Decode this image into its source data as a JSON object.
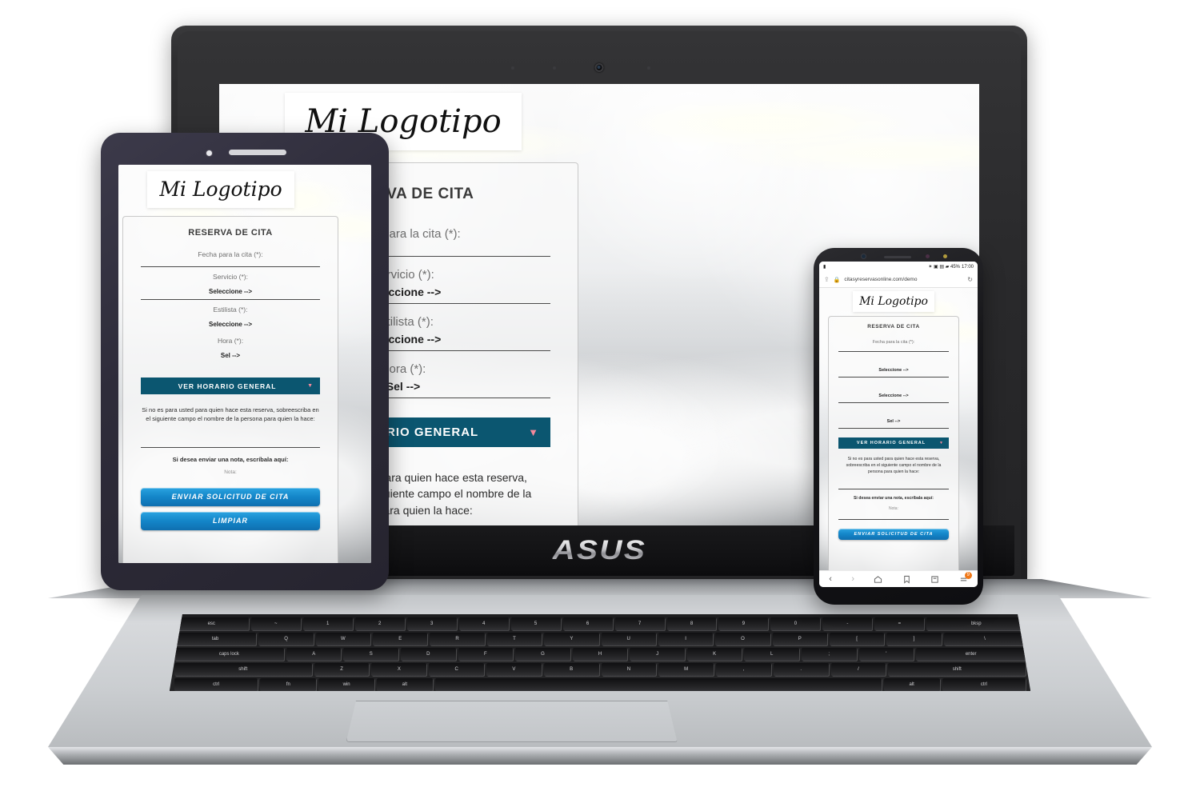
{
  "site": {
    "logo_text": "Mi Logotipo",
    "card_title": "RESERVA DE CITA",
    "fields": [
      {
        "label": "Fecha para la cita (*):",
        "value": ""
      },
      {
        "label": "Servicio (*):",
        "value": "Seleccione -->"
      },
      {
        "label": "Estilista (*):",
        "value": "Seleccione -->"
      },
      {
        "label": "Hora (*):",
        "value": "Sel -->"
      }
    ],
    "schedule_button": {
      "label": "VER HORARIO GENERAL",
      "arrow": "▼"
    },
    "note_paragraph": "Si no es para usted para quien hace esta reserva, sobreescriba en el siguiente campo el nombre de la persona para quien la hace:",
    "note_prompt": "Si desea enviar una nota, escríbala aquí:",
    "note_placeholder": "Nota:",
    "submit_button": "ENVIAR SOLICITUD DE CITA",
    "clear_button": "LIMPIAR",
    "colors": {
      "teal": "#0b5670",
      "arrow_pink": "#f4899b",
      "blue_button": "#1486c9"
    }
  },
  "laptop": {
    "brand": "ASUS",
    "keyboard": {
      "row1": [
        "esc",
        "~",
        "1",
        "2",
        "3",
        "4",
        "5",
        "6",
        "7",
        "8",
        "9",
        "0",
        "-",
        "=",
        "bksp"
      ],
      "row2": [
        "tab",
        "Q",
        "W",
        "E",
        "R",
        "T",
        "Y",
        "U",
        "I",
        "O",
        "P",
        "[",
        "]",
        "\\"
      ],
      "row3": [
        "caps lock",
        "A",
        "S",
        "D",
        "F",
        "G",
        "H",
        "J",
        "K",
        "L",
        ";",
        "'",
        "enter"
      ],
      "row4": [
        "shift",
        "Z",
        "X",
        "C",
        "V",
        "B",
        "N",
        "M",
        ",",
        ".",
        "/",
        "shift"
      ],
      "row5": [
        "ctrl",
        "fn",
        "win",
        "alt",
        "",
        "alt",
        "ctrl"
      ]
    }
  },
  "phone": {
    "url": "citasyreservasonline.com/demo",
    "status_time": "17:00",
    "status_icons": "✶ ▣ ▤ ▰ 45%",
    "lock_icon": "🔒",
    "nav": {
      "back": "‹",
      "forward": "›",
      "home": "home-icon",
      "bookmark": "bookmark-icon",
      "tabs": "tabs-icon",
      "menu": "menu-icon",
      "menu_badge": "9"
    }
  }
}
